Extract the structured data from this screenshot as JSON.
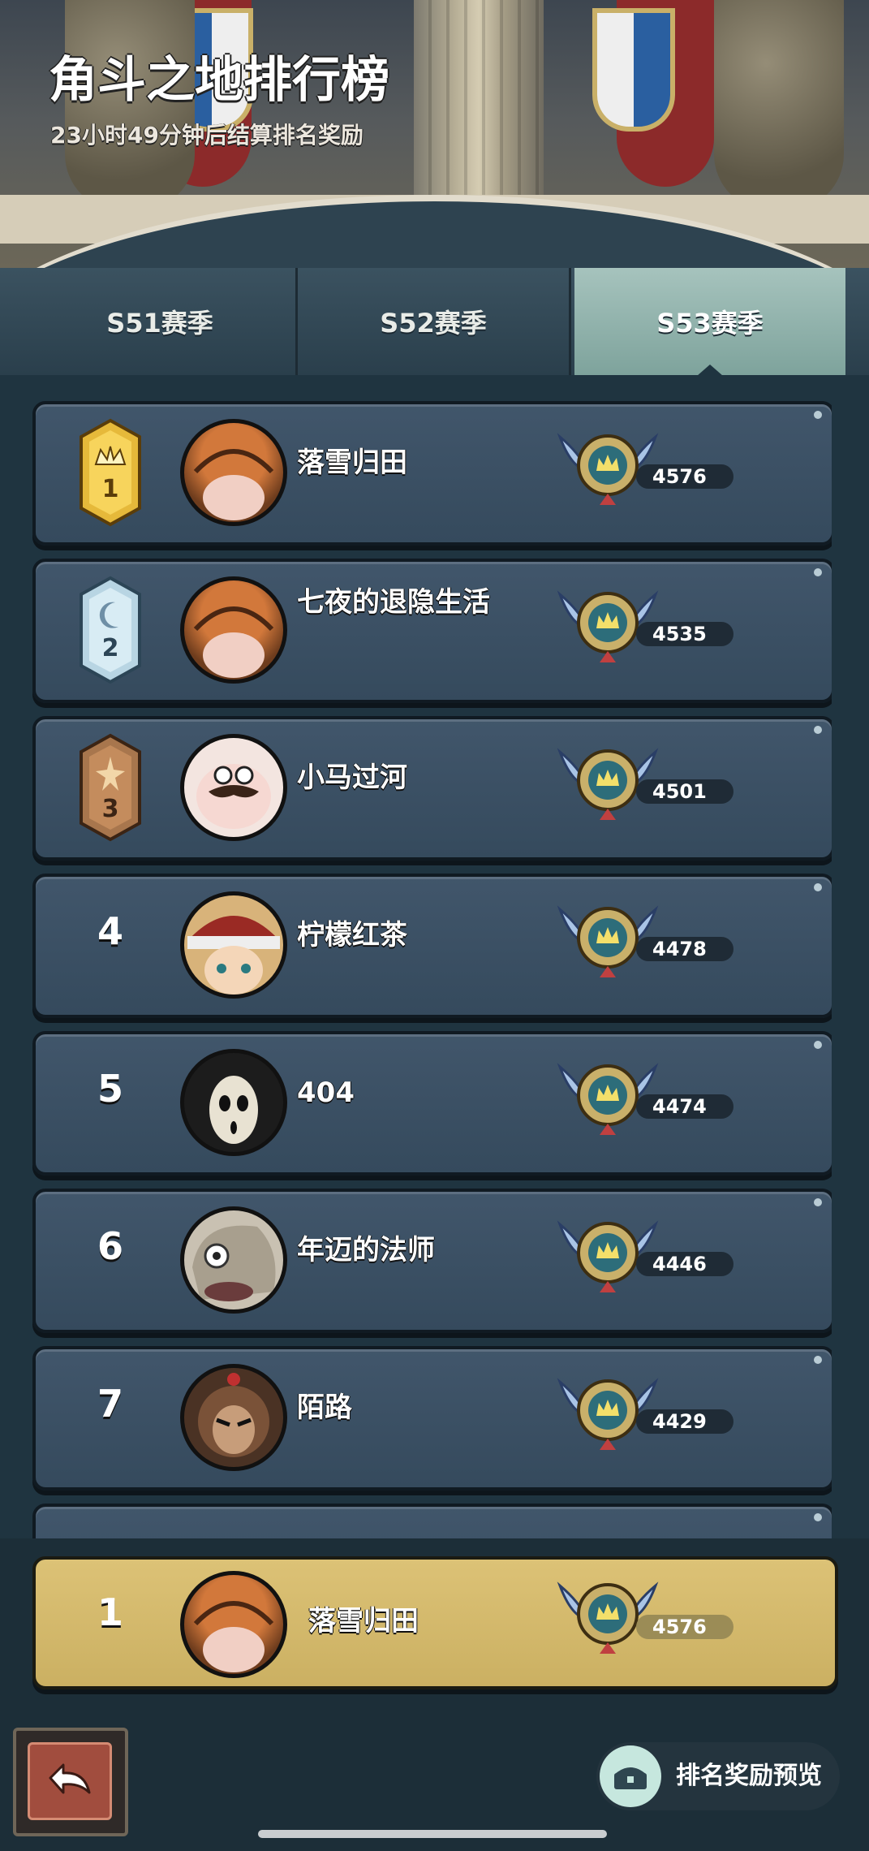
{
  "header": {
    "title": "角斗之地排行榜",
    "subtitle": "23小时49分钟后结算排名奖励"
  },
  "tabs": [
    {
      "label": "S51赛季",
      "active": false
    },
    {
      "label": "S52赛季",
      "active": false
    },
    {
      "label": "S53赛季",
      "active": true
    }
  ],
  "rankings": [
    {
      "rank": "1",
      "badge": "gold-crown-badge",
      "name": "落雪归田",
      "score": "4576",
      "avatar": "pumpkin-head"
    },
    {
      "rank": "2",
      "badge": "silver-moon-badge",
      "name": "七夜的退隐生活",
      "score": "4535",
      "avatar": "pumpkin-head"
    },
    {
      "rank": "3",
      "badge": "bronze-star-badge",
      "name": "小马过河",
      "score": "4501",
      "avatar": "mustache-pig"
    },
    {
      "rank": "4",
      "name": "柠檬红茶",
      "score": "4478",
      "avatar": "santa-hat-kid"
    },
    {
      "rank": "5",
      "name": "404",
      "score": "4474",
      "avatar": "skull-mask"
    },
    {
      "rank": "6",
      "name": "年迈的法师",
      "score": "4446",
      "avatar": "old-mage"
    },
    {
      "rank": "7",
      "name": "陌路",
      "score": "4429",
      "avatar": "monkey-king"
    }
  ],
  "my_rank": {
    "rank": "1",
    "name": "落雪归田",
    "score": "4576",
    "avatar": "pumpkin-head"
  },
  "footer": {
    "back_icon": "return-arrow-icon",
    "reward_icon": "reward-chest-icon",
    "reward_label": "排名奖励预览"
  },
  "colors": {
    "accent_tab": "#8fb3ac",
    "row_bg": "#3d5266",
    "my_row_bg": "#d6bc6e",
    "page_bg": "#1f3440"
  }
}
